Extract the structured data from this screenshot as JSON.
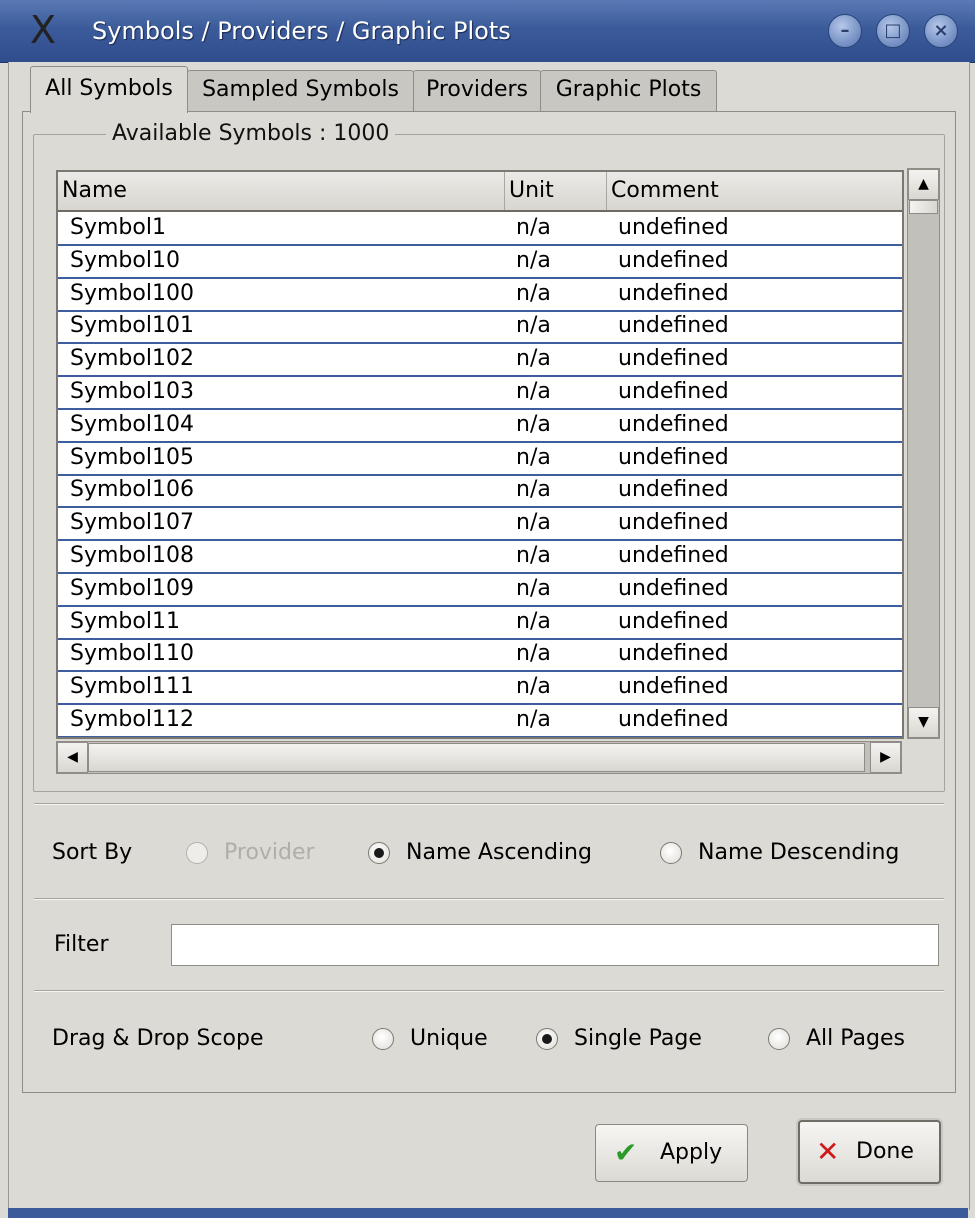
{
  "window": {
    "title": "Symbols / Providers / Graphic Plots",
    "app_icon": "X",
    "controls": {
      "minimize": "–",
      "maximize": "□",
      "close": "×"
    }
  },
  "tabs": [
    {
      "label": "All Symbols",
      "active": true
    },
    {
      "label": "Sampled Symbols",
      "active": false
    },
    {
      "label": "Providers",
      "active": false
    },
    {
      "label": "Graphic Plots",
      "active": false
    }
  ],
  "symbols_group": {
    "title": "Available Symbols : 1000",
    "columns": [
      "Name",
      "Unit",
      "Comment"
    ],
    "rows": [
      [
        "Symbol1",
        "n/a",
        "undefined"
      ],
      [
        "Symbol10",
        "n/a",
        "undefined"
      ],
      [
        "Symbol100",
        "n/a",
        "undefined"
      ],
      [
        "Symbol101",
        "n/a",
        "undefined"
      ],
      [
        "Symbol102",
        "n/a",
        "undefined"
      ],
      [
        "Symbol103",
        "n/a",
        "undefined"
      ],
      [
        "Symbol104",
        "n/a",
        "undefined"
      ],
      [
        "Symbol105",
        "n/a",
        "undefined"
      ],
      [
        "Symbol106",
        "n/a",
        "undefined"
      ],
      [
        "Symbol107",
        "n/a",
        "undefined"
      ],
      [
        "Symbol108",
        "n/a",
        "undefined"
      ],
      [
        "Symbol109",
        "n/a",
        "undefined"
      ],
      [
        "Symbol11",
        "n/a",
        "undefined"
      ],
      [
        "Symbol110",
        "n/a",
        "undefined"
      ],
      [
        "Symbol111",
        "n/a",
        "undefined"
      ],
      [
        "Symbol112",
        "n/a",
        "undefined"
      ]
    ]
  },
  "sort": {
    "label": "Sort By",
    "options": [
      {
        "label": "Provider",
        "checked": false,
        "disabled": true
      },
      {
        "label": "Name Ascending",
        "checked": true,
        "disabled": false
      },
      {
        "label": "Name Descending",
        "checked": false,
        "disabled": false
      }
    ]
  },
  "filter": {
    "label": "Filter",
    "value": "",
    "placeholder": ""
  },
  "scope": {
    "label": "Drag & Drop Scope",
    "options": [
      {
        "label": "Unique",
        "checked": false
      },
      {
        "label": "Single Page",
        "checked": true
      },
      {
        "label": "All Pages",
        "checked": false
      }
    ]
  },
  "buttons": {
    "apply": {
      "label": "Apply",
      "icon": "checkmark-icon",
      "icon_color": "#2a9a2a"
    },
    "done": {
      "label": "Done",
      "icon": "x-icon",
      "icon_color": "#d01818"
    }
  },
  "colors": {
    "titlebar": "#3c5b9a",
    "row_divider": "#3c5d9e",
    "background": "#dcdad5"
  }
}
